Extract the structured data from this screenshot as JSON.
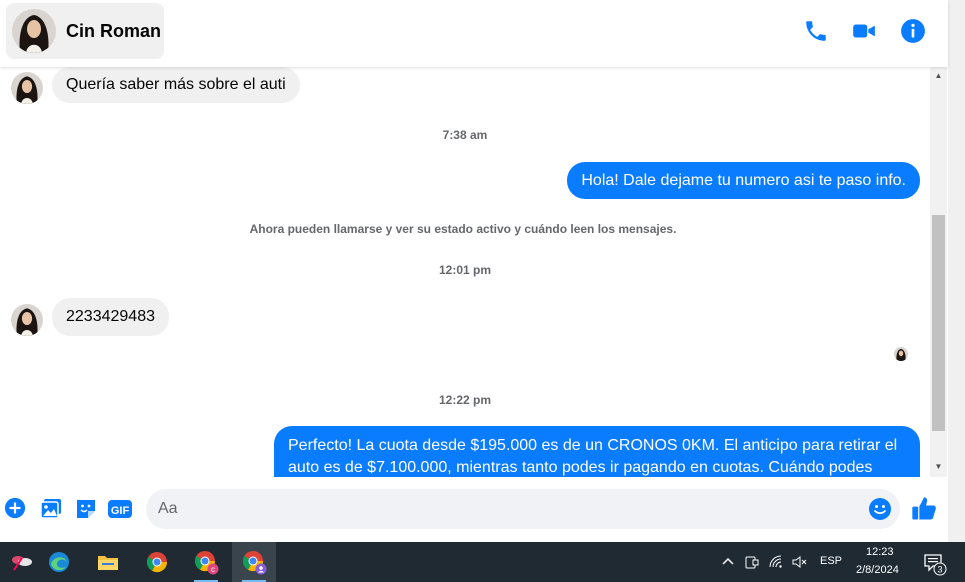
{
  "header": {
    "contact_name": "Cin Roman",
    "call_icon": "phone-icon",
    "video_icon": "video-camera-icon",
    "info_icon": "info-icon"
  },
  "messages": {
    "incoming_1": "Quería saber más sobre el auti",
    "timestamp_1": "7:38 am",
    "outgoing_1": "Hola! Dale dejame tu numero  asi te paso info.",
    "system_note": "Ahora pueden llamarse y ver su estado activo y cuándo leen los mensajes.",
    "timestamp_2": "12:01 pm",
    "incoming_2": "2233429483",
    "timestamp_3": "12:22 pm",
    "outgoing_2": "Perfecto! La cuota desde $195.000 es de un CRONOS 0KM. El anticipo para retirar el auto es de $7.100.000, mientras tanto podes ir pagando en cuotas. Cuándo podes"
  },
  "composer": {
    "placeholder": "Aa",
    "icons": [
      "plus-circle-icon",
      "photo-icon",
      "sticker-icon",
      "gif-icon",
      "emoji-icon",
      "thumbs-up-icon"
    ],
    "gif_label": "GIF"
  },
  "colors": {
    "accent": "#0a7cff",
    "bubble_in": "#f0f0f0",
    "taskbar": "#1f2a33"
  },
  "taskbar": {
    "apps": [
      "flower-app-icon",
      "edge-icon",
      "file-explorer-icon",
      "chrome-icon",
      "chrome-profile-c-icon",
      "chrome-profile-active-icon"
    ],
    "profile_badge": "c",
    "language": "ESP",
    "time": "12:23",
    "date": "2/8/2024",
    "notification_count": "3"
  }
}
